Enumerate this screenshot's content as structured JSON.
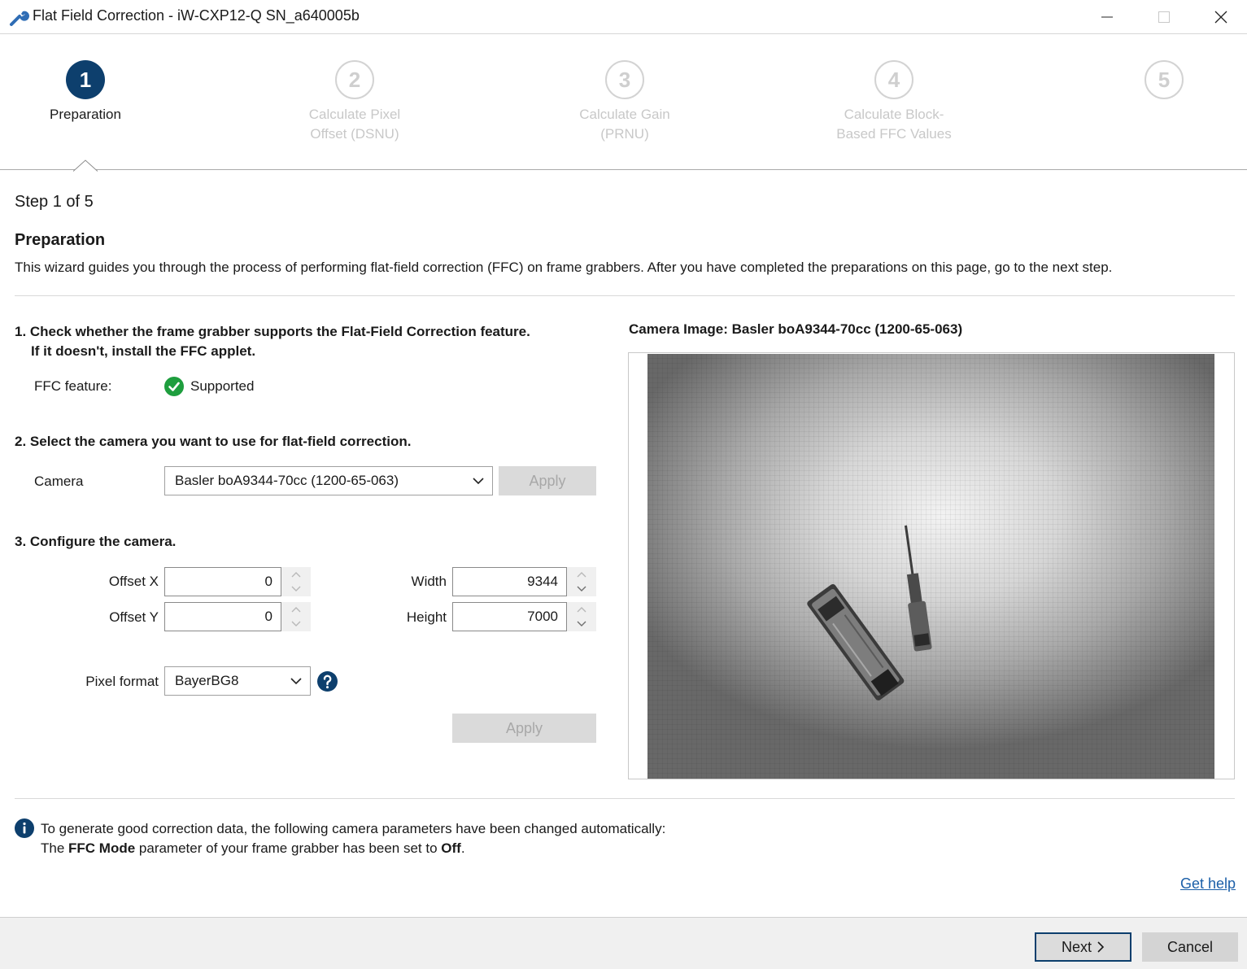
{
  "window": {
    "title": "Flat Field Correction - iW-CXP12-Q SN_a640005b",
    "icon": "wrench-icon"
  },
  "stepper": {
    "steps": [
      {
        "number": "1",
        "label": "Preparation",
        "state": "active"
      },
      {
        "number": "2",
        "label": "Calculate Pixel Offset (DSNU)",
        "state": "inactive"
      },
      {
        "number": "3",
        "label": "Calculate Gain (PRNU)",
        "state": "inactive"
      },
      {
        "number": "4",
        "label": "Calculate Block-Based FFC Values",
        "state": "inactive"
      },
      {
        "number": "5",
        "label": "",
        "state": "inactive"
      }
    ],
    "colors": {
      "active": "#0d3f6d",
      "inactive": "#d3d3d3"
    }
  },
  "page": {
    "step_counter": "Step 1 of 5",
    "heading": "Preparation",
    "description": "This wizard guides you through the process of performing flat-field correction (FFC) on frame grabbers. After you have completed the preparations on this page, go to the next step."
  },
  "section1": {
    "title_line1": "1. Check whether the frame grabber supports the Flat-Field Correction feature.",
    "title_line2": "If it doesn't, install the FFC applet.",
    "ffc_label": "FFC feature:",
    "ffc_status": "Supported",
    "status_color": "#1e9e3e"
  },
  "section2": {
    "title": "2. Select the camera you want to use for flat-field correction.",
    "camera_label": "Camera",
    "camera_value": "Basler boA9344-70cc (1200-65-063)",
    "apply_label": "Apply"
  },
  "section3": {
    "title": "3. Configure the camera.",
    "offset_x_label": "Offset X",
    "offset_x_value": "0",
    "offset_y_label": "Offset Y",
    "offset_y_value": "0",
    "width_label": "Width",
    "width_value": "9344",
    "height_label": "Height",
    "height_value": "7000",
    "pixel_format_label": "Pixel format",
    "pixel_format_value": "BayerBG8",
    "apply_label": "Apply"
  },
  "camera_image": {
    "title": "Camera Image: Basler boA9344-70cc (1200-65-063)"
  },
  "info": {
    "line1": "To generate good correction data, the following camera parameters have been changed automatically:",
    "line2_prefix": "The ",
    "line2_bold1": "FFC Mode",
    "line2_mid": " parameter of your frame grabber has been set to ",
    "line2_bold2": "Off",
    "line2_suffix": "."
  },
  "links": {
    "get_help": "Get help"
  },
  "footer": {
    "next_label": "Next",
    "cancel_label": "Cancel"
  }
}
